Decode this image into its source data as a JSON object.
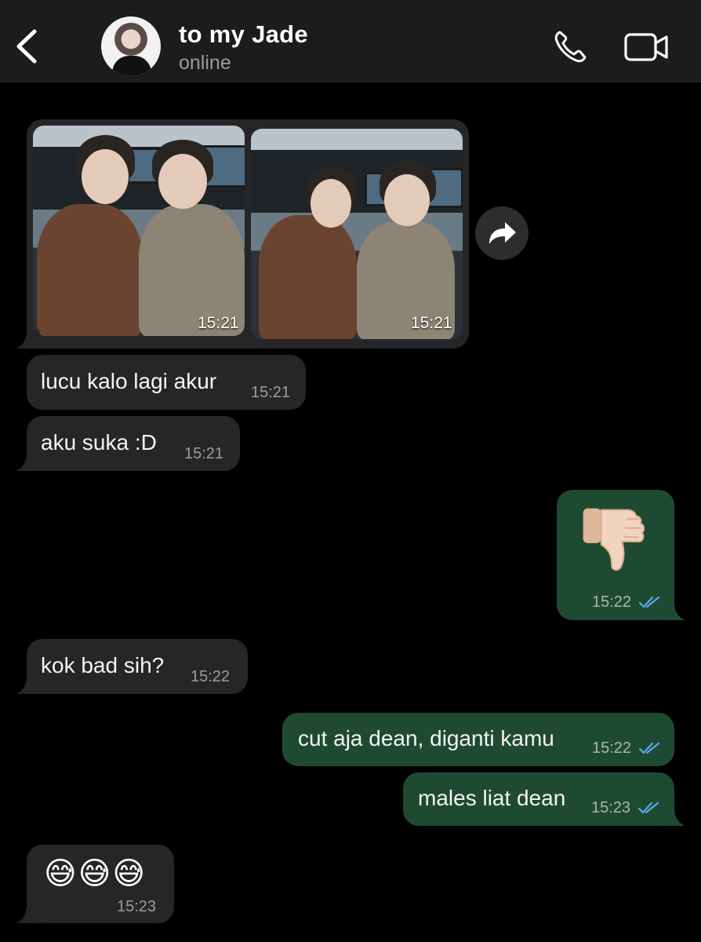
{
  "header": {
    "contact_name": "to my Jade",
    "status": "online",
    "back_icon": "chevron-left-icon",
    "call_icon": "phone-icon",
    "video_icon": "video-camera-icon"
  },
  "messages": [
    {
      "direction": "in",
      "type": "photos",
      "photo_times": [
        "15:21",
        "15:21"
      ]
    },
    {
      "direction": "in",
      "type": "text",
      "text": "lucu kalo lagi akur",
      "time": "15:21"
    },
    {
      "direction": "in",
      "type": "text",
      "text": "aku suka :D",
      "time": "15:21"
    },
    {
      "direction": "out",
      "type": "emoji",
      "emoji": "👎🏻",
      "time": "15:22",
      "status": "read"
    },
    {
      "direction": "in",
      "type": "text",
      "text": "kok bad sih?",
      "time": "15:22"
    },
    {
      "direction": "out",
      "type": "text",
      "text": "cut aja dean, diganti kamu",
      "time": "15:22",
      "status": "read"
    },
    {
      "direction": "out",
      "type": "text",
      "text": "males liat dean",
      "time": "15:23",
      "status": "read"
    },
    {
      "direction": "in",
      "type": "emoji",
      "emoji": "😅😅😅",
      "time": "15:23"
    }
  ],
  "colors": {
    "background": "#000000",
    "header": "#1c1c1d",
    "incoming_bubble": "#262628",
    "outgoing_bubble": "#1f4a32",
    "read_ticks": "#5aa9f0"
  }
}
